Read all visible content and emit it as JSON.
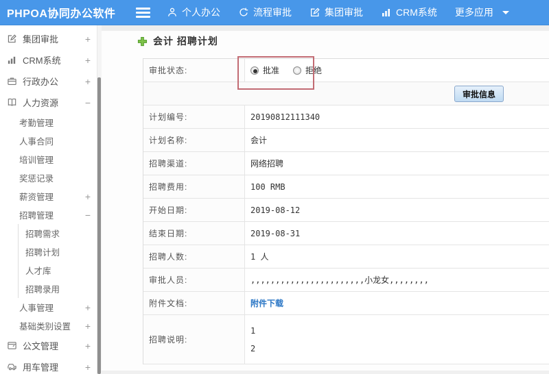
{
  "colors": {
    "navbar": "#4897e9",
    "annotation": "#c26b73",
    "link": "#2a76c5",
    "button_border": "#8aa8cc"
  },
  "navbar": {
    "logo": "PHPOA协同办公软件",
    "items": [
      {
        "name": "personal-office",
        "label": "个人办公",
        "icon": "user-icon"
      },
      {
        "name": "workflow-approval",
        "label": "流程审批",
        "icon": "process-icon"
      },
      {
        "name": "group-approval",
        "label": "集团审批",
        "icon": "edit-icon"
      },
      {
        "name": "crm-system",
        "label": "CRM系统",
        "icon": "chart-icon"
      },
      {
        "name": "more-apps",
        "label": "更多应用",
        "icon": "",
        "caret": true
      }
    ]
  },
  "sidebar": {
    "items": [
      {
        "name": "group-approval",
        "label": "集团审批",
        "icon": "edit-icon",
        "level": 1,
        "toggle": "+"
      },
      {
        "name": "crm-system",
        "label": "CRM系统",
        "icon": "chart-icon",
        "level": 1,
        "toggle": "+"
      },
      {
        "name": "admin-office",
        "label": "行政办公",
        "icon": "briefcase-icon",
        "level": 1,
        "toggle": "+"
      },
      {
        "name": "human-resources",
        "label": "人力资源",
        "icon": "book-icon",
        "level": 1,
        "toggle": "−"
      },
      {
        "name": "attendance-mgmt",
        "label": "考勤管理",
        "level": 2
      },
      {
        "name": "hr-contract",
        "label": "人事合同",
        "level": 2
      },
      {
        "name": "training-mgmt",
        "label": "培训管理",
        "level": 2
      },
      {
        "name": "reward-punish",
        "label": "奖惩记录",
        "level": 2
      },
      {
        "name": "salary-mgmt",
        "label": "薪资管理",
        "level": 2,
        "toggle": "+"
      },
      {
        "name": "recruit-mgmt",
        "label": "招聘管理",
        "level": 2,
        "toggle": "−"
      },
      {
        "name": "recruit-demand",
        "label": "招聘需求",
        "level": 3
      },
      {
        "name": "recruit-plan",
        "label": "招聘计划",
        "level": 3
      },
      {
        "name": "talent-pool",
        "label": "人才库",
        "level": 3
      },
      {
        "name": "recruit-hire",
        "label": "招聘录用",
        "level": 3
      },
      {
        "name": "personnel-mgmt",
        "label": "人事管理",
        "level": 2,
        "toggle": "+"
      },
      {
        "name": "base-category",
        "label": "基础类别设置",
        "level": 2,
        "toggle": "+"
      },
      {
        "name": "document-mgmt",
        "label": "公文管理",
        "icon": "doc-icon",
        "level": 1,
        "toggle": "+"
      },
      {
        "name": "vehicle-mgmt",
        "label": "用车管理",
        "icon": "car-icon",
        "level": 1,
        "toggle": "+"
      }
    ]
  },
  "breadcrumb": {
    "add_icon": "plus-icon",
    "title": "会计 招聘计划"
  },
  "form": {
    "status_label": "审批状态:",
    "radios": [
      {
        "label": "批准",
        "selected": true
      },
      {
        "label": "拒绝",
        "selected": false
      }
    ],
    "submit_button": "审批信息",
    "rows": [
      {
        "name": "plan-number",
        "label": "计划编号:",
        "value": "20190812111340"
      },
      {
        "name": "plan-name",
        "label": "计划名称:",
        "value": "会计"
      },
      {
        "name": "channel",
        "label": "招聘渠道:",
        "value": "网络招聘"
      },
      {
        "name": "cost",
        "label": "招聘费用:",
        "value": "100 RMB"
      },
      {
        "name": "start-date",
        "label": "开始日期:",
        "value": "2019-08-12"
      },
      {
        "name": "end-date",
        "label": "结束日期:",
        "value": "2019-08-31"
      },
      {
        "name": "headcount",
        "label": "招聘人数:",
        "value": "1 人"
      },
      {
        "name": "approvers",
        "label": "审批人员:",
        "value": ",,,,,,,,,,,,,,,,,,,,,,,小龙女,,,,,,,,"
      },
      {
        "name": "attachment",
        "label": "附件文档:",
        "value": "附件下载",
        "type": "link"
      },
      {
        "name": "description",
        "label": "招聘说明:",
        "type": "multiline",
        "lines": [
          "1",
          "2"
        ]
      }
    ]
  }
}
